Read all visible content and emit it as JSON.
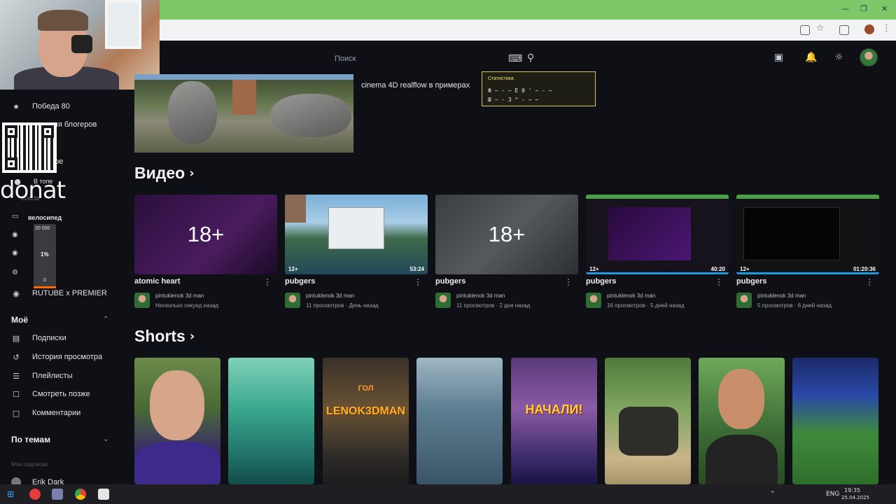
{
  "header": {
    "search_placeholder": "Поиск"
  },
  "sidebar": {
    "items_top": [
      {
        "label": "Победа 80",
        "icon": "80-badge-icon"
      },
      {
        "label": "для блогеров",
        "icon": "blogger-icon"
      },
      {
        "label": "рное",
        "icon": "grid-icon"
      },
      {
        "label": "В топе",
        "icon": "flame-icon"
      },
      {
        "label": "Shorts",
        "icon": "shorts-icon"
      },
      {
        "label": "RUTUBE x PREMIER",
        "icon": "premier-icon"
      }
    ],
    "my_section": {
      "title": "Моё",
      "items": [
        {
          "label": "Подписки",
          "icon": "subscriptions-icon"
        },
        {
          "label": "История просмотра",
          "icon": "history-icon"
        },
        {
          "label": "Плейлисты",
          "icon": "playlist-icon"
        },
        {
          "label": "Смотреть позже",
          "icon": "watch-later-icon"
        },
        {
          "label": "Комментарии",
          "icon": "comments-icon"
        }
      ]
    },
    "topics_section": {
      "title": "По темам"
    },
    "subs_label": "Мои подписки",
    "subscription": "Erik Dark"
  },
  "overlay": {
    "donat_text": "donat",
    "goal_title": "велосипед",
    "goal_amount": "20 000",
    "goal_percent": "1%",
    "goal_zero": "0",
    "goal_progress_fraction": 0.01
  },
  "hero": {
    "title": "cinema 4D realflow в примерах"
  },
  "stats": {
    "title": "Статистика",
    "line1": "Ф ~ - ~ Е 0  ' ~ - ~",
    "line2": "Ш ~ - 3  ^ - ~ ~"
  },
  "sections": {
    "videos": "Видео",
    "shorts": "Shorts"
  },
  "videos": [
    {
      "title": "atomic heart",
      "channel": "pintuklenok 3d man",
      "meta": "Несколько секунд назад",
      "age": "",
      "duration": "",
      "overlay": "18+",
      "progress": 0
    },
    {
      "title": "pubgers",
      "channel": "pintuklenok 3d man",
      "meta": "11 просмотров · День назад",
      "age": "12+",
      "duration": "53:24",
      "overlay": "",
      "progress": 0
    },
    {
      "title": "pubgers",
      "channel": "pintuklenok 3d man",
      "meta": "11 просмотров · 2 дня назад",
      "age": "",
      "duration": "",
      "overlay": "18+",
      "progress": 0
    },
    {
      "title": "pubgers",
      "channel": "pintuklenok 3d man",
      "meta": "16 просмотров · 5 дней назад",
      "age": "12+",
      "duration": "40:20",
      "overlay": "",
      "progress": 1
    },
    {
      "title": "pubgers",
      "channel": "pintuklenok 3d man",
      "meta": "5 просмотров · 6 дней назад",
      "age": "12+",
      "duration": "01:20:36",
      "overlay": "",
      "progress": 1
    }
  ],
  "shorts": [
    {
      "text": ""
    },
    {
      "text": ""
    },
    {
      "text": "LENOK3DMAN",
      "sub": "ГОЛ"
    },
    {
      "text": ""
    },
    {
      "text": "НАЧАЛИ!"
    },
    {
      "text": ""
    },
    {
      "text": ""
    },
    {
      "text": ""
    }
  ],
  "taskbar": {
    "lang": "ENG",
    "time": "19:35",
    "date": "25.04.2025"
  },
  "colors": {
    "chrome_green": "#7fc86a",
    "background": "#0f1015",
    "progress_blue": "#1a9be0",
    "goal_orange": "#ff6a00"
  }
}
